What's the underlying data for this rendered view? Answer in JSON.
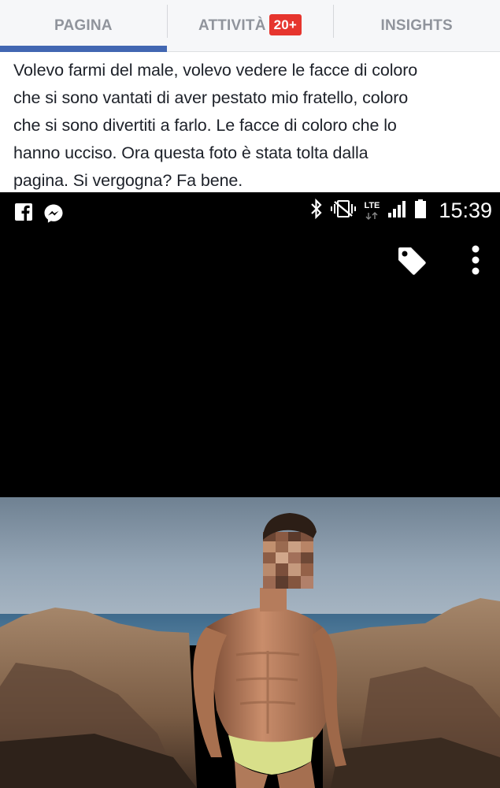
{
  "tabs": [
    {
      "label": "PAGINA",
      "active": true
    },
    {
      "label": "ATTIVITÀ",
      "badge": "20+",
      "active": false
    },
    {
      "label": "INSIGHTS",
      "active": false
    }
  ],
  "colors": {
    "accent": "#4267b2",
    "badge": "#e6352e",
    "tab_text": "#90949c"
  },
  "post": {
    "lines": [
      "Volevo farmi del male, volevo vedere le facce di coloro",
      "che si sono vantati di aver pestato mio fratello, coloro",
      "che si sono divertiti a farlo. Le facce di coloro che lo",
      "hanno ucciso. Ora questa foto è stata tolta dalla",
      "pagina. Si vergogna? Fa bene."
    ]
  },
  "statusbar": {
    "left_icons": [
      "facebook-icon",
      "messenger-icon"
    ],
    "right_icons": [
      "bluetooth-icon",
      "vibrate-icon",
      "lte-icon",
      "signal-icon",
      "battery-icon"
    ],
    "network": "LTE",
    "time": "15:39"
  },
  "viewer": {
    "actions": [
      "tag-icon",
      "more-vertical-icon"
    ]
  },
  "photo": {
    "subject": "shirtless man on rocks by the sea, face pixelated"
  }
}
